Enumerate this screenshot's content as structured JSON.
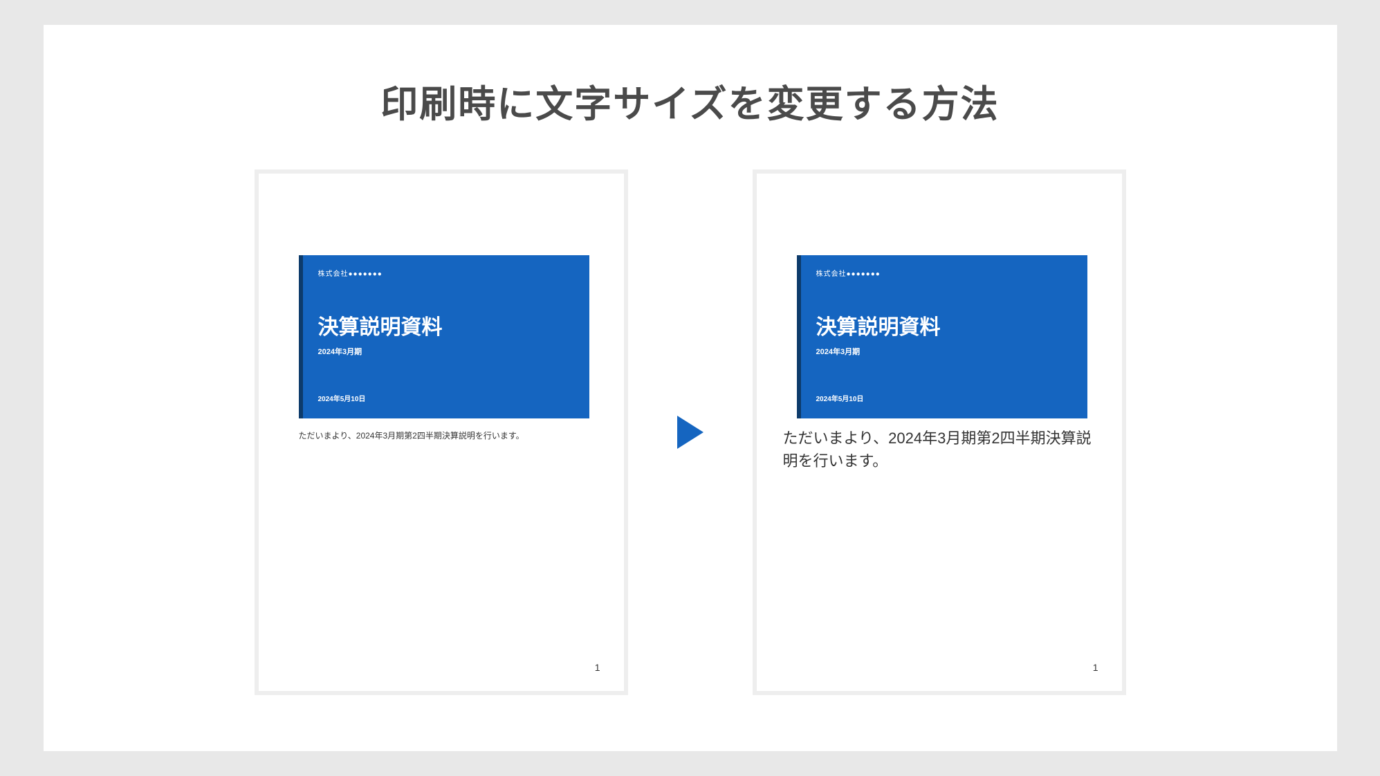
{
  "heading": "印刷時に文字サイズを変更する方法",
  "left": {
    "slide": {
      "company": "株式会社●●●●●●●",
      "title": "決算説明資料",
      "subtitle": "2024年3月期",
      "date": "2024年5月10日"
    },
    "note": "ただいまより、2024年3月期第2四半期決算説明を行います。",
    "page_number": "1"
  },
  "right": {
    "slide": {
      "company": "株式会社●●●●●●●",
      "title": "決算説明資料",
      "subtitle": "2024年3月期",
      "date": "2024年5月10日"
    },
    "note": "ただいまより、2024年3月期第2四半期決算説明を行います。",
    "page_number": "1"
  }
}
